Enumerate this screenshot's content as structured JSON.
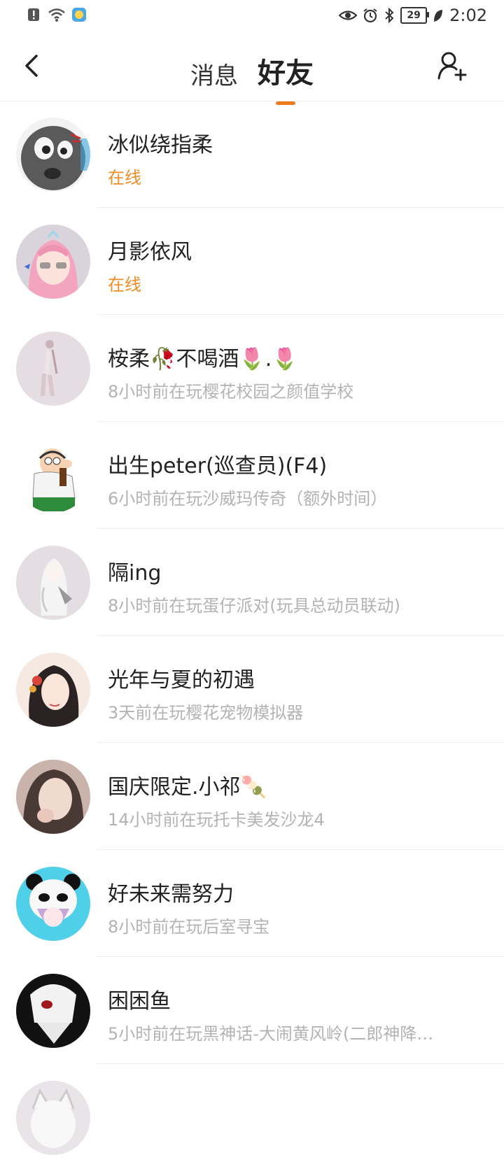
{
  "status_bar": {
    "time": "2:02",
    "battery": "29"
  },
  "header": {
    "tabs": [
      {
        "label": "消息",
        "active": false
      },
      {
        "label": "好友",
        "active": true
      }
    ],
    "accent_color": "#f07b1c"
  },
  "friends": [
    {
      "name": "冰似绕指柔",
      "status": "在线",
      "online": true
    },
    {
      "name": "月影依风",
      "status": "在线",
      "online": true
    },
    {
      "name": "桉柔🥀不喝酒🌷.🌷",
      "status": "8小时前在玩樱花校园之颜值学校",
      "online": false
    },
    {
      "name": "出生peter(巡查员)(F4)",
      "status": "6小时前在玩沙威玛传奇（额外时间）",
      "online": false
    },
    {
      "name": "隔ing",
      "status": "8小时前在玩蛋仔派对(玩具总动员联动)",
      "online": false
    },
    {
      "name": "光年与夏的初遇",
      "status": "3天前在玩樱花宠物模拟器",
      "online": false
    },
    {
      "name": "国庆限定.小祁🍡",
      "status": "14小时前在玩托卡美发沙龙4",
      "online": false
    },
    {
      "name": "好未来需努力",
      "status": "8小时前在玩后室寻宝",
      "online": false
    },
    {
      "name": "困困鱼",
      "status": "5小时前在玩黑神话-大闹黄风岭(二郎神降…",
      "online": false
    }
  ]
}
